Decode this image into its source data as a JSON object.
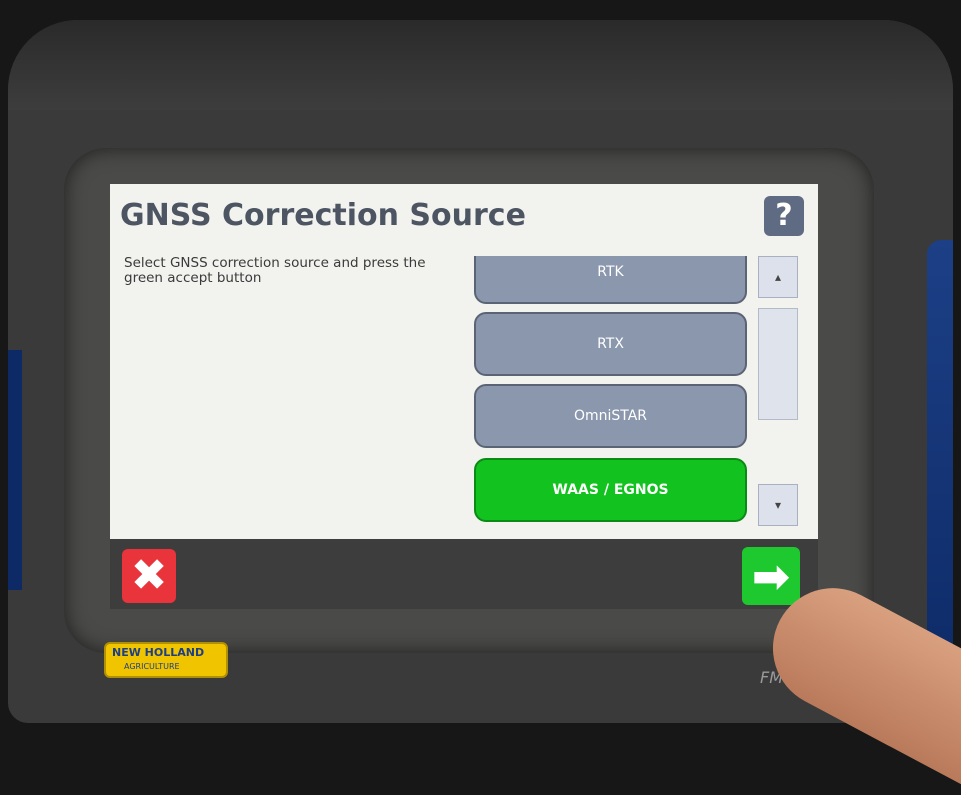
{
  "screen": {
    "title": "GNSS Correction Source",
    "help_label": "?",
    "instructions": "Select GNSS correction source and press the green accept button"
  },
  "options": [
    {
      "label": "RTK",
      "selected": false
    },
    {
      "label": "RTX",
      "selected": false
    },
    {
      "label": "OmniSTAR",
      "selected": false
    },
    {
      "label": "WAAS / EGNOS",
      "selected": true
    }
  ],
  "scrollbar": {
    "up_glyph": "▴",
    "down_glyph": "▾"
  },
  "footer": {
    "cancel_glyph": "✖",
    "accept_glyph": "➡"
  },
  "device": {
    "brand_line1": "NEW HOLLAND",
    "brand_line2": "AGRICULTURE",
    "model": "FM-750"
  },
  "colors": {
    "selected_option": "#12c21e",
    "option": "#8a97ad",
    "cancel": "#e8343a",
    "accept": "#1ec92f",
    "title_text": "#4d5563"
  }
}
